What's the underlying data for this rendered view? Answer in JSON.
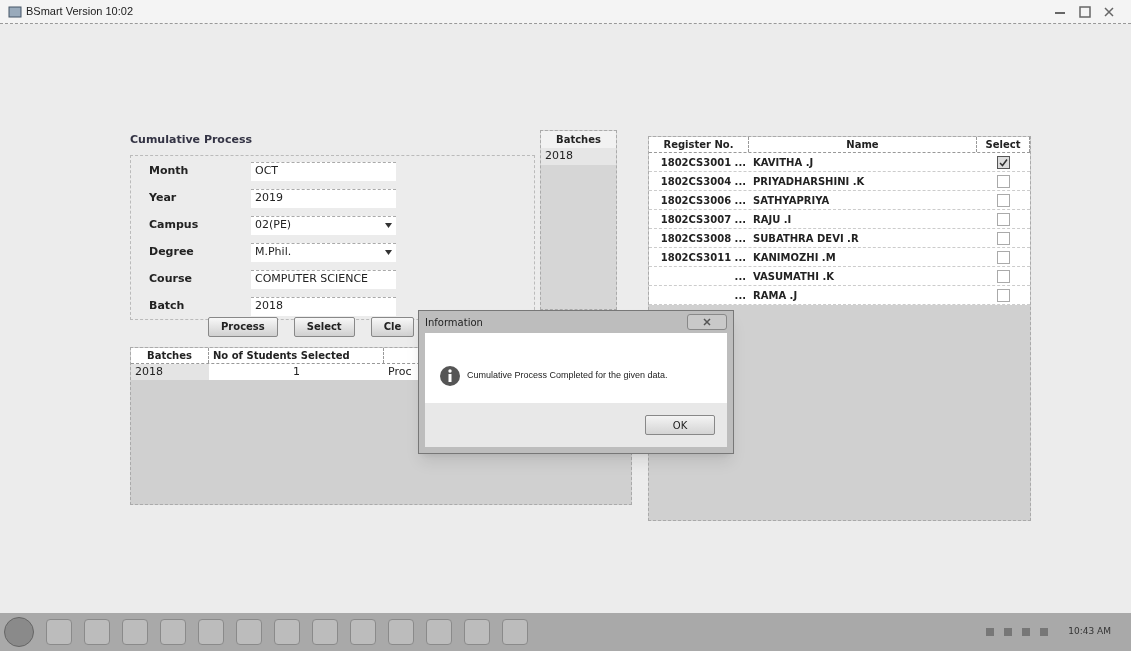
{
  "window": {
    "title": "BSmart Version 10:02"
  },
  "form": {
    "title": "Cumulative Process",
    "fields": [
      {
        "label": "Month",
        "value": "OCT",
        "kind": "text"
      },
      {
        "label": "Year",
        "value": "2019",
        "kind": "text"
      },
      {
        "label": "Campus",
        "value": "02(PE)",
        "kind": "combo"
      },
      {
        "label": "Degree",
        "value": "M.Phil.",
        "kind": "combo"
      },
      {
        "label": "Course",
        "value": "COMPUTER SCIENCE",
        "kind": "text"
      },
      {
        "label": "Batch",
        "value": "2018",
        "kind": "text"
      }
    ]
  },
  "buttons": [
    "Process",
    "Select",
    "Cle"
  ],
  "batches_list": {
    "header": "Batches",
    "items": [
      "2018"
    ]
  },
  "summary_table": {
    "columns": [
      "Batches",
      "No of Students Selected"
    ],
    "rows": [
      [
        "2018",
        "1",
        "Proc"
      ]
    ]
  },
  "students_table": {
    "columns": [
      "Register No.",
      "Name",
      "Select"
    ],
    "rows": [
      {
        "register": "1802CS3001 ...",
        "name": "KAVITHA .J",
        "checked": true
      },
      {
        "register": "1802CS3004 ...",
        "name": "PRIYADHARSHINI .K",
        "checked": false
      },
      {
        "register": "1802CS3006 ...",
        "name": "SATHYAPRIYA",
        "checked": false
      },
      {
        "register": "1802CS3007 ...",
        "name": "RAJU .I",
        "checked": false
      },
      {
        "register": "1802CS3008 ...",
        "name": "SUBATHRA DEVI .R",
        "checked": false
      },
      {
        "register": "1802CS3011 ...",
        "name": "KANIMOZHI .M",
        "checked": false
      },
      {
        "register": "...",
        "name": "VASUMATHI .K",
        "checked": false
      },
      {
        "register": "...",
        "name": "RAMA .J",
        "checked": false
      }
    ]
  },
  "dialog": {
    "title": "Information",
    "message": "Cumulative Process Completed for the given data.",
    "button": "OK"
  },
  "taskbar": {
    "clock": "10:43 AM"
  }
}
